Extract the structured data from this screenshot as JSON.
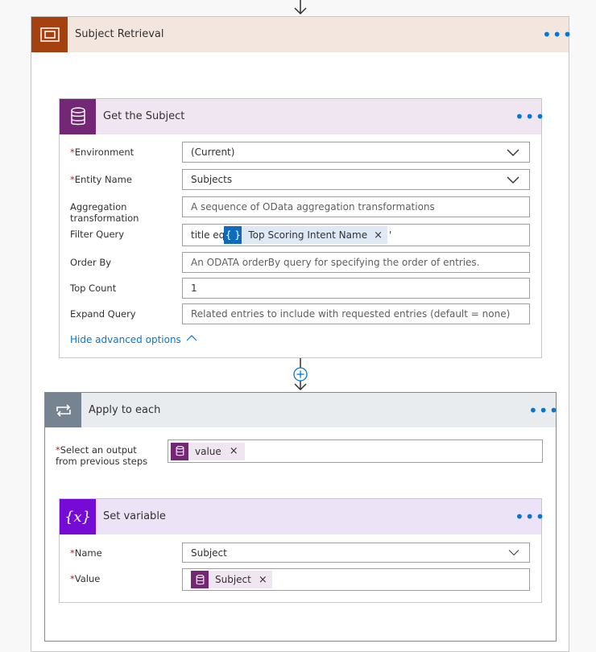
{
  "scope": {
    "title": "Subject Retrieval",
    "icon": "scope-icon"
  },
  "get_subject": {
    "title": "Get the Subject",
    "icon": "database-icon",
    "fields": {
      "environment": {
        "label": "Environment",
        "value": "(Current)"
      },
      "entity_name": {
        "label": "Entity Name",
        "value": "Subjects"
      },
      "aggregation": {
        "label_line1": "Aggregation",
        "label_line2": "transformation",
        "placeholder": "A sequence of OData aggregation transformations"
      },
      "filter_query": {
        "label": "Filter Query",
        "prefix": "title eq '",
        "token": "Top Scoring Intent Name",
        "suffix": "'"
      },
      "order_by": {
        "label": "Order By",
        "placeholder": "An ODATA orderBy query for specifying the order of entries."
      },
      "top_count": {
        "label": "Top Count",
        "value": "1"
      },
      "expand_query": {
        "label": "Expand Query",
        "placeholder": "Related entries to include with requested entries (default = none)"
      }
    },
    "hide_advanced": "Hide advanced options"
  },
  "apply_each": {
    "title": "Apply to each",
    "icon": "loop-icon",
    "select_label_line1": "Select an output",
    "select_label_line2": "from previous steps",
    "token": "value"
  },
  "set_variable": {
    "title": "Set variable",
    "icon": "variable-icon",
    "icon_glyph": "{x}",
    "fields": {
      "name": {
        "label": "Name",
        "value": "Subject"
      },
      "value": {
        "label": "Value",
        "token": "Subject"
      }
    }
  },
  "required_mark": "*",
  "remove_glyph": "×",
  "colors": {
    "scope_accent": "#a4410e",
    "cds_accent": "#742774",
    "apply_accent": "#768492",
    "variable_accent": "#770bd6",
    "expression_token": "#0f6cbd",
    "link": "#0078d4"
  }
}
